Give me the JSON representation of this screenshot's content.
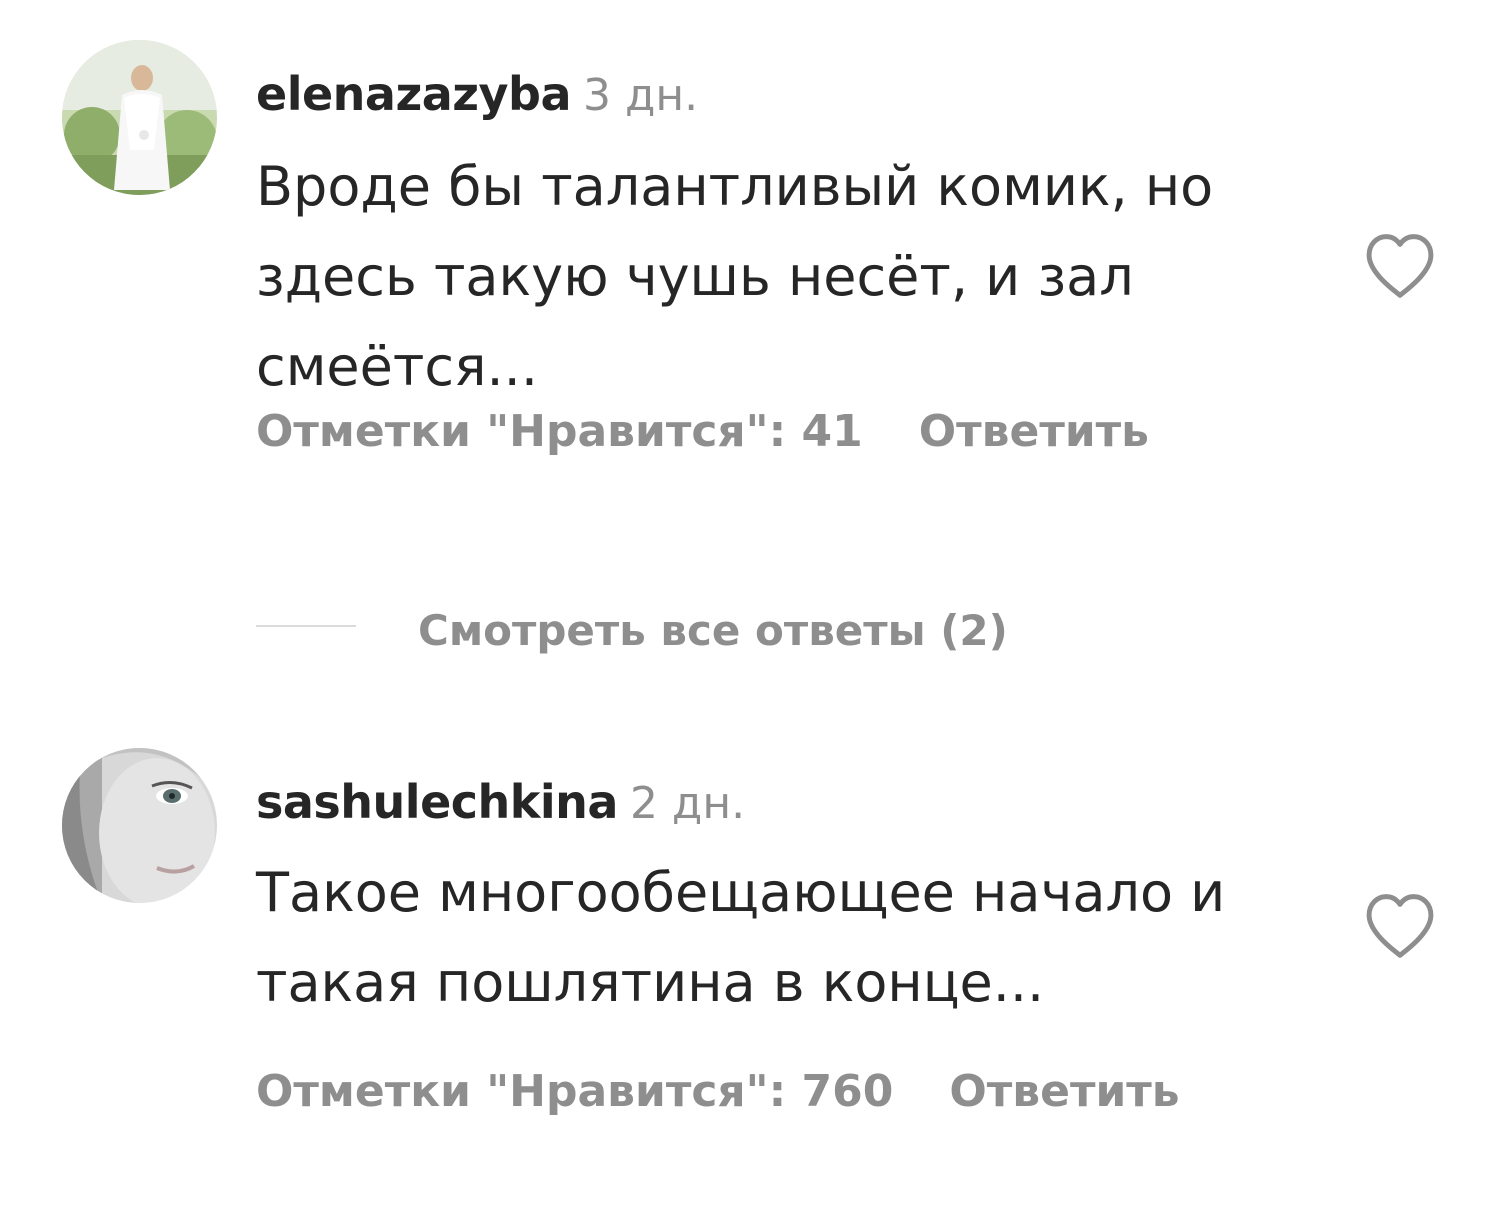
{
  "comments": [
    {
      "username": "elenazazyba",
      "time": "3 дн.",
      "text": "Вроде бы талантливый комик, но здесь такую чушь несёт, и зал смеётся...",
      "likes_label": "Отметки \"Нравится\": 41",
      "reply_label": "Ответить",
      "view_replies_label": "Смотреть все ответы (2)",
      "icons": {
        "avatar": "avatar-photo",
        "like": "heart-outline-icon"
      }
    },
    {
      "username": "sashulechkina",
      "time": "2 дн.",
      "text": "Такое многообещающее начало и такая пошлятина в конце...",
      "likes_label": "Отметки \"Нравится\": 760",
      "reply_label": "Ответить",
      "icons": {
        "avatar": "avatar-photo",
        "like": "heart-outline-icon"
      }
    }
  ],
  "colors": {
    "primary_text": "#262626",
    "secondary_text": "#8e8e8e",
    "divider": "#dbdbdb",
    "background": "#ffffff"
  }
}
